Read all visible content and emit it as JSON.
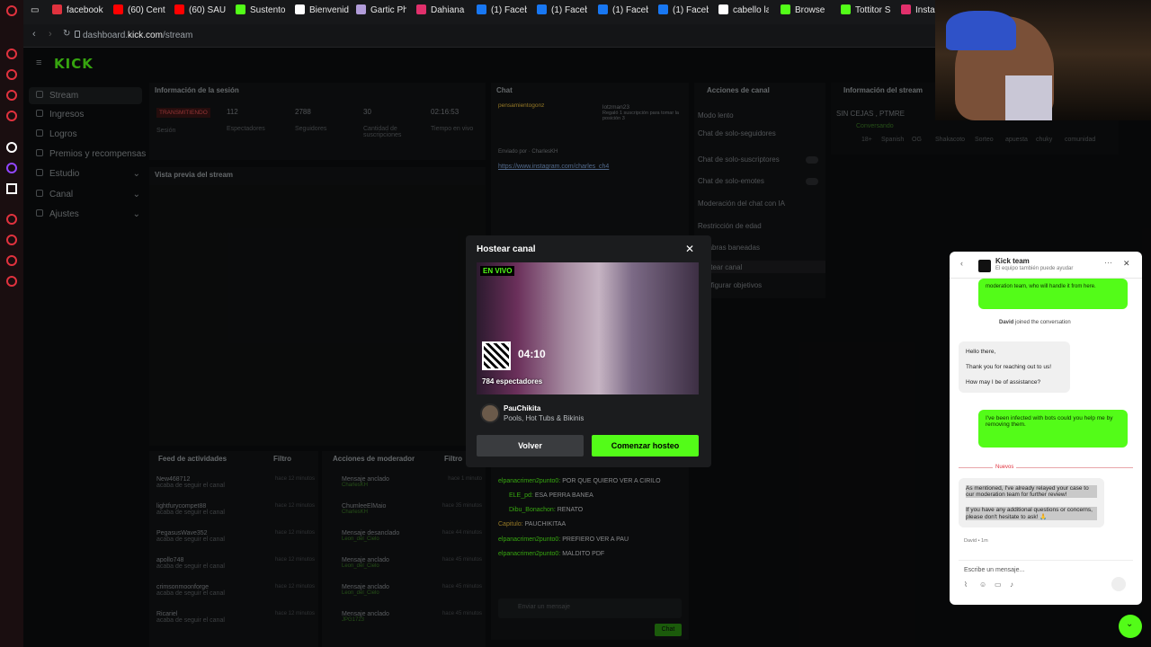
{
  "browser": {
    "tabs": [
      {
        "label": "facebook",
        "color": "#e0323e"
      },
      {
        "label": "(60) Cent",
        "color": "#ff0000"
      },
      {
        "label": "(60) SAU",
        "color": "#ff0000"
      },
      {
        "label": "Sustento",
        "color": "#53fc18"
      },
      {
        "label": "Bienvenid",
        "color": "#ffffff"
      },
      {
        "label": "Gartic Ph",
        "color": "#b19cd9"
      },
      {
        "label": "Dahiana I",
        "color": "#e1306c"
      },
      {
        "label": "(1) Faceb",
        "color": "#1877f2"
      },
      {
        "label": "(1) Faceb",
        "color": "#1877f2"
      },
      {
        "label": "(1) Faceb",
        "color": "#1877f2"
      },
      {
        "label": "(1) Faceb",
        "color": "#1877f2"
      },
      {
        "label": "cabello la",
        "color": "#ffffff"
      },
      {
        "label": "Browse",
        "color": "#53fc18"
      },
      {
        "label": "Tottitor S",
        "color": "#53fc18"
      },
      {
        "label": "Instag",
        "color": "#e1306c"
      }
    ],
    "url_prefix": "dashboard.",
    "url_domain": "kick.com",
    "url_path": "/stream"
  },
  "sidebar": {
    "logo": "KICK",
    "items": [
      {
        "label": "Stream"
      },
      {
        "label": "Ingresos"
      },
      {
        "label": "Logros"
      },
      {
        "label": "Premios y recompensas"
      },
      {
        "label": "Estudio"
      },
      {
        "label": "Canal"
      },
      {
        "label": "Ajustes"
      }
    ]
  },
  "session": {
    "title": "Información de la sesión",
    "status": "TRANSMITIENDO",
    "status_label": "Sesión",
    "stats": [
      {
        "value": "112",
        "label": "Espectadores"
      },
      {
        "value": "2788",
        "label": "Seguidores"
      },
      {
        "value": "30",
        "label": "Cantidad de suscripciones"
      },
      {
        "value": "02:16:53",
        "label": "Tiempo en vivo"
      }
    ],
    "preview_title": "Vista previa del stream"
  },
  "chat_panel": {
    "title": "Chat",
    "pinned_user": "pensamientogonz",
    "pinned_name": "lotzman23",
    "pinned_text": "Regaló 1 suscripción para tomar la posición 3",
    "pinned_by": "Enviado por",
    "pinned_by_user": "CharlesKH",
    "link": "https://www.instagram.com/charles_ch4",
    "messages": [
      {
        "user": "elpanacrimen2punto0:",
        "text": "POR QUE QUIERO VER A CIRILO"
      },
      {
        "user": "ELE_pd:",
        "text": "ESA PERRA BANEA"
      },
      {
        "user": "Dibu_Bonachon:",
        "text": "RENATO"
      },
      {
        "user": "Capitulo:",
        "text": "PAUCHIKITAA"
      },
      {
        "user": "elpanacrimen2punto0:",
        "text": "PREFIERO VER A PAU"
      },
      {
        "user": "elpanacrimen2punto0:",
        "text": "MALDITO PDF"
      }
    ],
    "input_placeholder": "Enviar un mensaje",
    "send_label": "Chat"
  },
  "channel_actions": {
    "title": "Acciones de canal",
    "items": [
      {
        "label": "Modo lento"
      },
      {
        "label": "Chat de solo-seguidores"
      },
      {
        "label": "Chat de solo-suscriptores"
      },
      {
        "label": "Chat de solo-emotes"
      },
      {
        "label": "Moderación del chat con IA"
      },
      {
        "label": "Restricción de edad"
      },
      {
        "label": "Palabras baneadas"
      },
      {
        "label": "Hostear canal"
      },
      {
        "label": "Configurar objetivos"
      }
    ]
  },
  "stream_info": {
    "title": "Información del stream",
    "stream_title": "SIN CEJAS , PTMRE",
    "category": "Conversando",
    "tags": [
      "18+",
      "Spanish",
      "OG",
      "Shakacoto",
      "Sorteo",
      "apuesta",
      "chuky",
      "comunidad"
    ]
  },
  "activity": {
    "title": "Feed de actividades",
    "filter": "Filtro",
    "items": [
      {
        "user": "New468712",
        "text": "acaba de seguir el canal",
        "time": "hace 12 minutos"
      },
      {
        "user": "lightfurycompet88",
        "text": "acaba de seguir el canal",
        "time": "hace 12 minutos"
      },
      {
        "user": "PegasusWave352",
        "text": "acaba de seguir el canal",
        "time": "hace 12 minutos"
      },
      {
        "user": "apollo748",
        "text": "acaba de seguir el canal",
        "time": "hace 12 minutos"
      },
      {
        "user": "crimsonmoonforge",
        "text": "acaba de seguir el canal",
        "time": "hace 12 minutos"
      },
      {
        "user": "Ricariel",
        "text": "acaba de seguir el canal",
        "time": "hace 12 minutos"
      }
    ]
  },
  "mod_actions": {
    "title": "Acciones de moderador",
    "filter": "Filtro",
    "items": [
      {
        "action": "Mensaje anclado",
        "by": "CharlesKH",
        "time": "hace 1 minuto"
      },
      {
        "action": "ChumleeElMaio",
        "by": "CharlesKH",
        "time": "hace 35 minutos"
      },
      {
        "action": "Mensaje desanclado",
        "by": "Leon_del_Cielo",
        "time": "hace 44 minutos"
      },
      {
        "action": "Mensaje anclado",
        "by": "Leon_del_Cielo",
        "time": "hace 45 minutos"
      },
      {
        "action": "Mensaje anclado",
        "by": "Leon_del_Cielo",
        "time": "hace 45 minutos"
      },
      {
        "action": "Mensaje anclado",
        "by": "JPG1723",
        "time": "hace 45 minutos"
      }
    ]
  },
  "modal": {
    "title": "Hostear canal",
    "live_badge": "EN VIVO",
    "timer": "04:10",
    "viewers": "784 espectadores",
    "channel_name": "PauChikita",
    "category": "Pools, Hot Tubs & Bikinis",
    "back_label": "Volver",
    "start_label": "Comenzar hosteo"
  },
  "support_chat": {
    "name": "Kick team",
    "subtitle": "El equipo también puede ayudar",
    "prev_text": "moderation team, who will handle it from here.",
    "joined_user": "David",
    "joined_text": " joined the conversation",
    "agent_greeting": [
      "Hello there,",
      "Thank you for reaching out to us!",
      "How may I be of assistance?"
    ],
    "user_msg": "I've been infected with bots could you help me by removing them.",
    "new_label": "Nuevos",
    "agent_reply": [
      "As mentioned, I've already relayed your case to our moderation team for further review!",
      "If you have any additional questions or concerns, please don't hesitate to ask! 🙏"
    ],
    "meta": "David • 1m",
    "input_placeholder": "Escribe un mensaje..."
  },
  "colors": {
    "brand": "#53fc18",
    "opera": "#e0323e"
  }
}
